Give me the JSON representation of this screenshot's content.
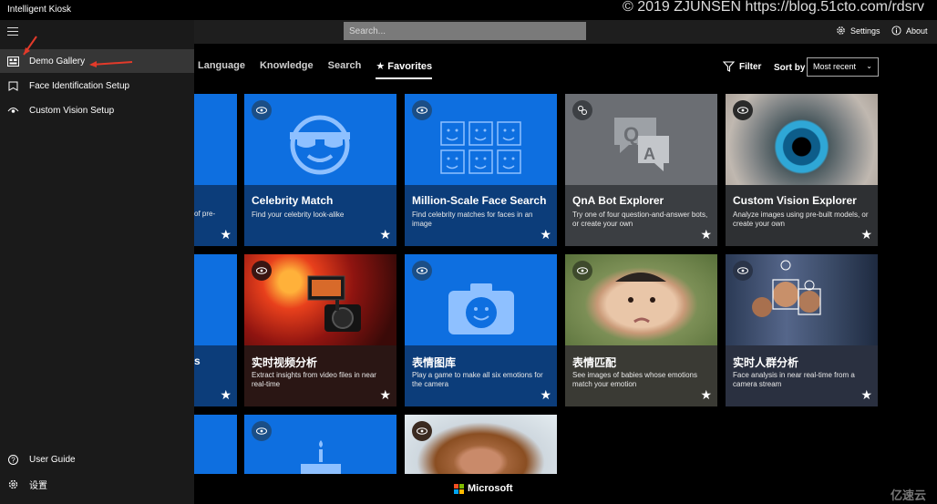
{
  "window": {
    "title": "Intelligent Kiosk",
    "watermark": "© 2019 ZJUNSEN https://blog.51cto.com/rdsrv",
    "corner_mark": "亿速云"
  },
  "header": {
    "search_placeholder": "Search...",
    "settings_label": "Settings",
    "about_label": "About"
  },
  "nav": {
    "items": [
      {
        "label": "Demo Gallery",
        "icon": "gallery-icon",
        "selected": true
      },
      {
        "label": "Face Identification Setup",
        "icon": "face-id-icon"
      },
      {
        "label": "Custom Vision Setup",
        "icon": "eye-icon"
      }
    ],
    "bottom": [
      {
        "label": "User Guide",
        "icon": "help-icon"
      },
      {
        "label": "设置",
        "icon": "gear-icon"
      }
    ]
  },
  "tabs": [
    {
      "label": "Language"
    },
    {
      "label": "Knowledge"
    },
    {
      "label": "Search"
    },
    {
      "label": "★ Favorites",
      "active": true
    }
  ],
  "toolbar": {
    "filter_label": "Filter",
    "sort_label": "Sort by",
    "sort_value": "Most recent"
  },
  "tiles": [
    {
      "title": "Celebrity Match",
      "desc": "Find your celebrity look-alike"
    },
    {
      "title": "Million-Scale Face Search",
      "desc": "Find celebrity matches for faces in an image"
    },
    {
      "title": "QnA Bot Explorer",
      "desc": "Try one of four question-and-answer bots, or create your own"
    },
    {
      "title": "Custom Vision Explorer",
      "desc": "Analyze images using pre-built models, or create your own"
    },
    {
      "title": "实时视频分析",
      "desc": "Extract insights from video files in near real-time"
    },
    {
      "title": "表情图库",
      "desc": "Play a game to make all six emotions for the camera"
    },
    {
      "title": "表情匹配",
      "desc": "See images of babies whose emotions match your emotion"
    },
    {
      "title": "实时人群分析",
      "desc": "Face analysis in near real-time from a camera stream"
    }
  ],
  "partial_tile": {
    "desc": "of pre-"
  },
  "footer": {
    "brand": "Microsoft"
  }
}
